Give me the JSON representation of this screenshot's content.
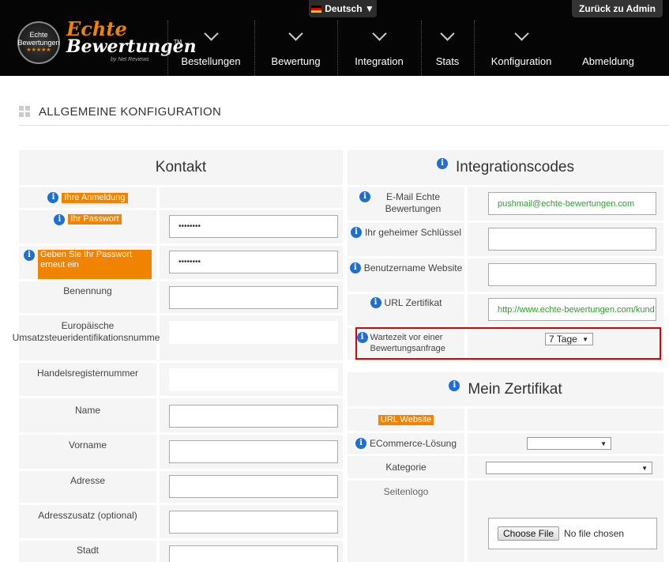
{
  "header": {
    "language": "Deutsch ▼",
    "back_to_admin": "Zurück zu Admin",
    "logo": {
      "line1": "Echte",
      "line2": "Bewertungen",
      "tm": "TM",
      "byline": "by Net Reviews",
      "badge_line1": "Echte",
      "badge_line2": "Bewertungen",
      "badge_stars": "★★★★★"
    },
    "nav": [
      {
        "label": "Bestellungen"
      },
      {
        "label": "Bewertung"
      },
      {
        "label": "Integration"
      },
      {
        "label": "Stats"
      },
      {
        "label": "Konfiguration"
      },
      {
        "label": "Abmeldung"
      }
    ]
  },
  "page_title": "ALLGEMEINE KONFIGURATION",
  "kontakt": {
    "title": "Kontakt",
    "rows": {
      "anmeldung": {
        "label": "Ihre Anmeldung"
      },
      "passwort": {
        "label": "Ihr Passwort",
        "value": "••••••••"
      },
      "passwort_repeat": {
        "label": "Geben Sie Ihr Passwort erneut ein",
        "value": "••••••••"
      },
      "benennung": {
        "label": "Benennung",
        "value": ""
      },
      "ust": {
        "label": "Europäische Umsatzsteueridentifikationsnummer",
        "value": ""
      },
      "handelsregister": {
        "label": "Handelsregisternummer",
        "value": ""
      },
      "name": {
        "label": "Name",
        "value": ""
      },
      "vorname": {
        "label": "Vorname",
        "value": ""
      },
      "adresse": {
        "label": "Adresse",
        "value": ""
      },
      "adresszusatz": {
        "label": "Adresszusatz (optional)",
        "value": ""
      },
      "stadt": {
        "label": "Stadt",
        "value": ""
      }
    }
  },
  "integration": {
    "title": "Integrationscodes",
    "rows": {
      "email": {
        "label": "E-Mail Echte Bewertungen",
        "value": "pushmail@echte-bewertungen.com"
      },
      "schluessel": {
        "label": "Ihr geheimer Schlüssel",
        "value": ""
      },
      "benutzername": {
        "label": "Benutzername Website",
        "value": ""
      },
      "url_zertifikat": {
        "label": "URL Zertifikat",
        "value": "http://www.echte-bewertungen.com/kund"
      },
      "wartezeit": {
        "label": "Wartezeit vor einer Bewertungsanfrage",
        "selected": "7 Tage"
      }
    }
  },
  "zertifikat": {
    "title": "Mein Zertifikat",
    "rows": {
      "url_website": {
        "label": "URL Website"
      },
      "ecommerce": {
        "label": "ECommerce-Lösung",
        "selected": ""
      },
      "kategorie": {
        "label": "Kategorie",
        "selected": ""
      },
      "seitenlogo": {
        "label": "Seitenlogo",
        "button": "Choose File",
        "status": "No file chosen"
      }
    }
  },
  "colors": {
    "accent": "#f08300",
    "info": "#1e6fcf",
    "highlight": "#e00000",
    "link_green": "#2fa12f"
  }
}
